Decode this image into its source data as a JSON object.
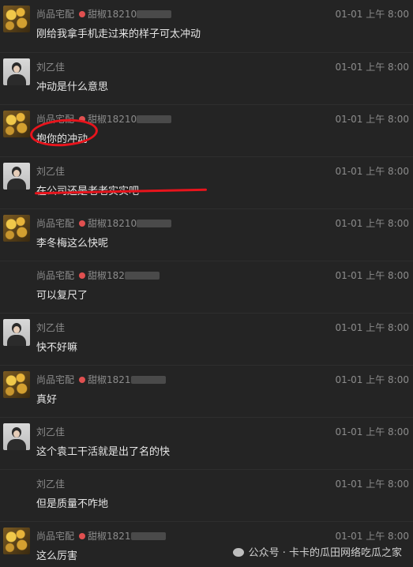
{
  "messages": [
    {
      "sender": "尚品宅配",
      "extra": "甜椒18210",
      "avatar": "gold-avatar",
      "time": "01-01 上午 8:00",
      "text": "刚给我拿手机走过来的样子可太冲动"
    },
    {
      "sender": "刘乙佳",
      "avatar": "portrait-avatar",
      "time": "01-01 上午 8:00",
      "text": "冲动是什么意思"
    },
    {
      "sender": "尚品宅配",
      "extra": "甜椒18210",
      "avatar": "gold-avatar",
      "time": "01-01 上午 8:00",
      "text": "抱你的冲动"
    },
    {
      "sender": "刘乙佳",
      "avatar": "portrait-avatar",
      "time": "01-01 上午 8:00",
      "text": "在公司还是老老实实吧"
    },
    {
      "sender": "尚品宅配",
      "extra": "甜椒18210",
      "avatar": "gold-avatar",
      "time": "01-01 上午 8:00",
      "text": "李冬梅这么快呢"
    },
    {
      "sender": "尚品宅配",
      "extra": "甜椒182",
      "avatar": "",
      "time": "01-01 上午 8:00",
      "text": "可以复尺了"
    },
    {
      "sender": "刘乙佳",
      "avatar": "portrait-avatar",
      "time": "01-01 上午 8:00",
      "text": "快不好嘛"
    },
    {
      "sender": "尚品宅配",
      "extra": "甜椒1821",
      "avatar": "gold-avatar",
      "time": "01-01 上午 8:00",
      "text": "真好"
    },
    {
      "sender": "刘乙佳",
      "avatar": "portrait-avatar",
      "time": "01-01 上午 8:00",
      "text": "这个袁工干活就是出了名的快"
    },
    {
      "sender": "刘乙佳",
      "avatar": "",
      "time": "01-01 上午 8:00",
      "text": "但是质量不咋地"
    },
    {
      "sender": "尚品宅配",
      "extra": "甜椒1821",
      "avatar": "gold-avatar",
      "time": "01-01 上午 8:00",
      "text": "这么厉害"
    }
  ],
  "watermark": "公众号 · 卡卡的瓜田网络吃瓜之家",
  "colors": {
    "background": "#242424",
    "annotation": "#e8141c"
  }
}
